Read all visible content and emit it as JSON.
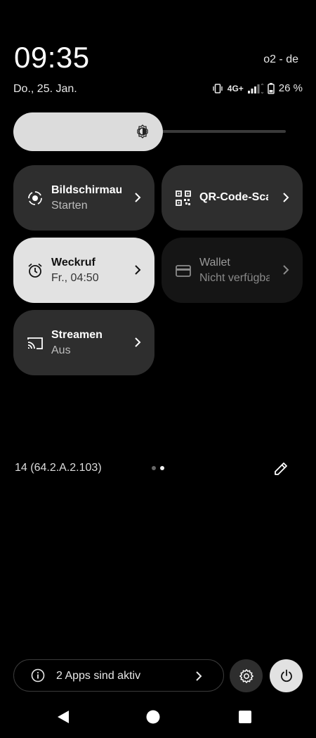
{
  "status_bar": {
    "time": "09:35",
    "carrier": "o2 - de",
    "date": "Do., 25. Jan.",
    "network_type": "4G+",
    "battery": "26 %"
  },
  "brightness": {
    "level": 0.55,
    "icon": "brightness-icon"
  },
  "tiles": [
    {
      "title": "Bildschirmaufnahme",
      "subtitle": "Starten",
      "icon": "screen-record-icon",
      "state": "off"
    },
    {
      "title": "QR-Code-Scanner",
      "subtitle": "",
      "icon": "qr-code-icon",
      "state": "off"
    },
    {
      "title": "Weckruf",
      "subtitle": "Fr., 04:50",
      "icon": "alarm-icon",
      "state": "on"
    },
    {
      "title": "Wallet",
      "subtitle": "Nicht verfügbar",
      "icon": "wallet-icon",
      "state": "unavailable"
    },
    {
      "title": "Streamen",
      "subtitle": "Aus",
      "icon": "cast-icon",
      "state": "off"
    }
  ],
  "footer": {
    "build_number": "14 (64.2.A.2.103)",
    "page_count": 2,
    "current_page": 2
  },
  "bottom": {
    "active_apps_label": "2 Apps sind aktiv"
  },
  "colors": {
    "background": "#000000",
    "tile_off": "#2e2e2e",
    "tile_on": "#e2e2e2",
    "tile_unavailable": "#151515"
  }
}
